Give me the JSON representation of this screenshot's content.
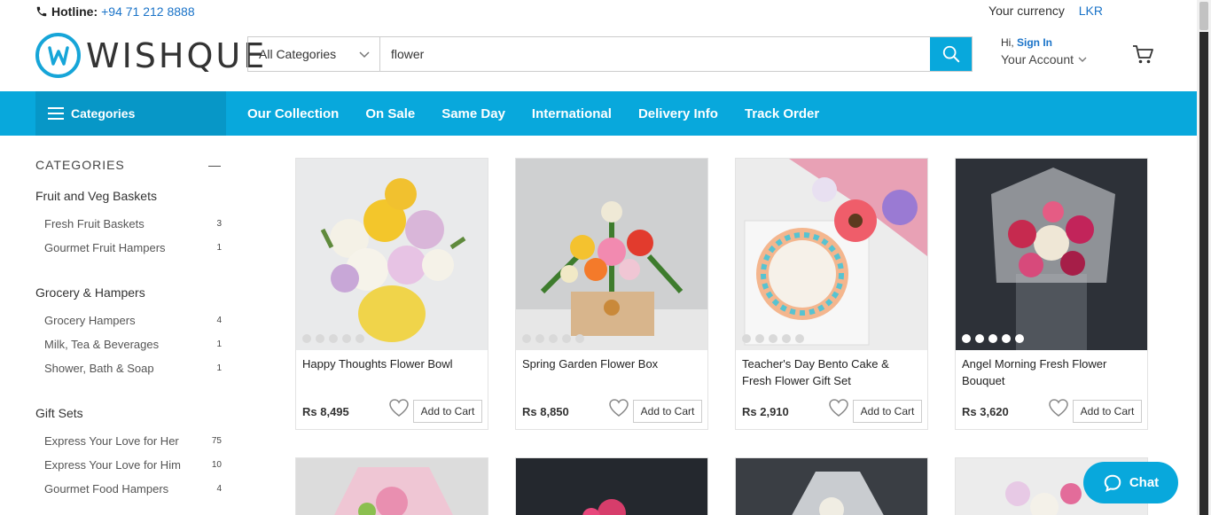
{
  "header": {
    "hotline_label": "Hotline:",
    "hotline_number": "+94 71 212 8888",
    "currency_label": "Your currency",
    "currency_value": "LKR",
    "logo_text": "WISHQUE",
    "search_category": "All Categories",
    "search_value": "flower",
    "account_hi": "Hi,",
    "account_signin": "Sign In",
    "account_label": "Your Account"
  },
  "nav": {
    "categories_label": "Categories",
    "links": [
      "Our Collection",
      "On Sale",
      "Same Day",
      "International",
      "Delivery Info",
      "Track Order"
    ]
  },
  "sidebar": {
    "heading": "CATEGORIES",
    "collapse_icon": "—",
    "groups": [
      {
        "title": "Fruit and Veg Baskets",
        "items": [
          {
            "label": "Fresh Fruit Baskets",
            "count": "3"
          },
          {
            "label": "Gourmet Fruit Hampers",
            "count": "1"
          }
        ]
      },
      {
        "title": "Grocery & Hampers",
        "items": [
          {
            "label": "Grocery Hampers",
            "count": "4"
          },
          {
            "label": "Milk, Tea & Beverages",
            "count": "1"
          },
          {
            "label": "Shower, Bath & Soap",
            "count": "1"
          }
        ]
      },
      {
        "title": "Gift Sets",
        "items": [
          {
            "label": "Express Your Love for Her",
            "count": "75"
          },
          {
            "label": "Express Your Love for Him",
            "count": "10"
          },
          {
            "label": "Gourmet Food Hampers",
            "count": "4"
          }
        ]
      }
    ]
  },
  "products": [
    {
      "title": "Happy Thoughts Flower Bowl",
      "price": "Rs 8,495",
      "add_label": "Add to Cart",
      "rating": 0
    },
    {
      "title": "Spring Garden Flower Box",
      "price": "Rs 8,850",
      "add_label": "Add to Cart",
      "rating": 0
    },
    {
      "title": "Teacher's Day Bento Cake & Fresh Flower Gift Set",
      "price": "Rs 2,910",
      "add_label": "Add to Cart",
      "rating": 0
    },
    {
      "title": "Angel Morning Fresh Flower Bouquet",
      "price": "Rs 3,620",
      "add_label": "Add to Cart",
      "rating": 5
    }
  ],
  "chat": {
    "label": "Chat"
  },
  "colors": {
    "accent": "#08a8dc",
    "link": "#1a73c8"
  }
}
